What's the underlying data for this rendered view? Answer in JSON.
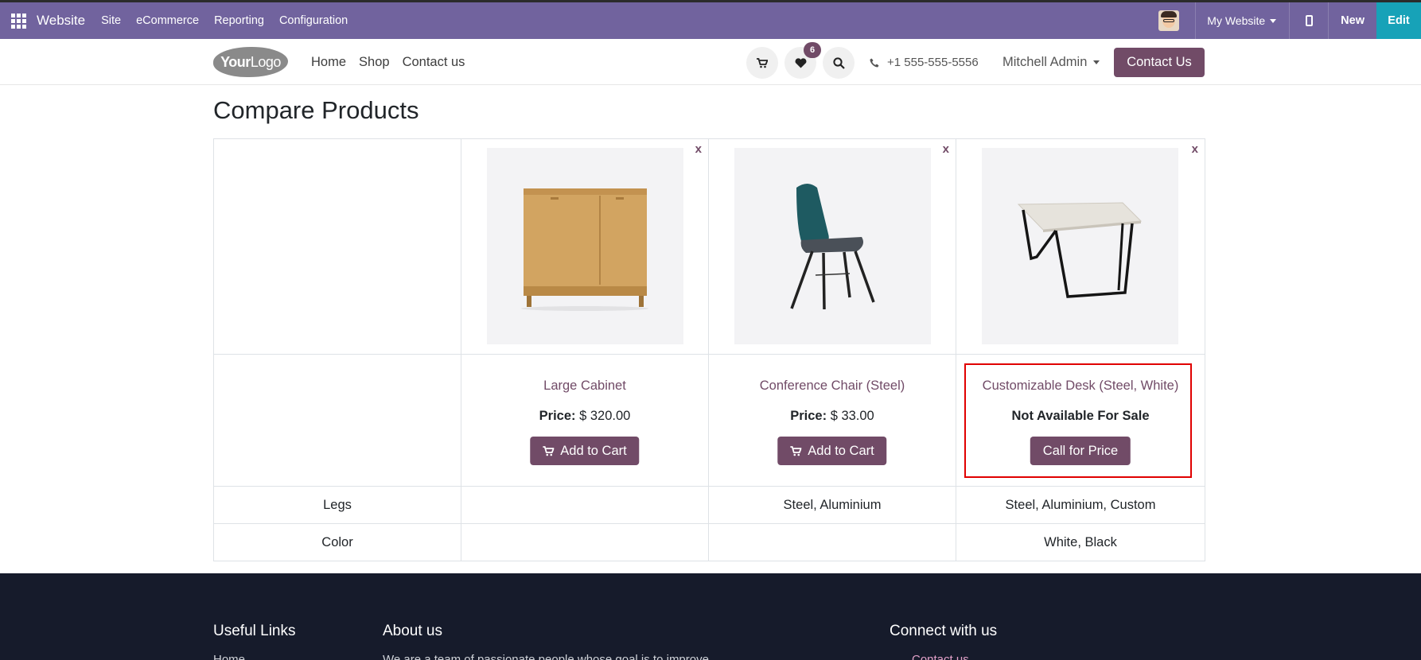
{
  "admin_bar": {
    "brand": "Website",
    "menu": [
      "Site",
      "eCommerce",
      "Reporting",
      "Configuration"
    ],
    "website_selector": "My Website",
    "new_label": "New",
    "edit_label": "Edit"
  },
  "header": {
    "logo_bold": "Your",
    "logo_light": "Logo",
    "nav": [
      "Home",
      "Shop",
      "Contact us"
    ],
    "wishlist_count": "6",
    "phone": "+1 555-555-5556",
    "user": "Mitchell Admin",
    "contact_button": "Contact Us"
  },
  "page_title": "Compare Products",
  "remove_label": "x",
  "products": [
    {
      "name": "Large Cabinet",
      "price_label": "Price:",
      "price": "$ 320.00",
      "button": "Add to Cart"
    },
    {
      "name": "Conference Chair (Steel)",
      "price_label": "Price:",
      "price": "$ 33.00",
      "button": "Add to Cart"
    },
    {
      "name": "Customizable Desk (Steel, White)",
      "availability": "Not Available For Sale",
      "button": "Call for Price"
    }
  ],
  "attributes": [
    {
      "name": "Legs",
      "values": [
        "",
        "Steel, Aluminium",
        "Steel, Aluminium, Custom"
      ]
    },
    {
      "name": "Color",
      "values": [
        "",
        "",
        "White, Black"
      ]
    }
  ],
  "footer": {
    "col1_title": "Useful Links",
    "col1_first": "Home",
    "col2_title": "About us",
    "col2_text": "We are a team of passionate people whose goal is to improve",
    "col3_title": "Connect with us",
    "col3_first": "Contact us"
  },
  "colors": {
    "admin_bar": "#71639e",
    "primary": "#714b67",
    "edit": "#17a2b8",
    "footer": "#161b2b",
    "highlight": "#e00000"
  }
}
